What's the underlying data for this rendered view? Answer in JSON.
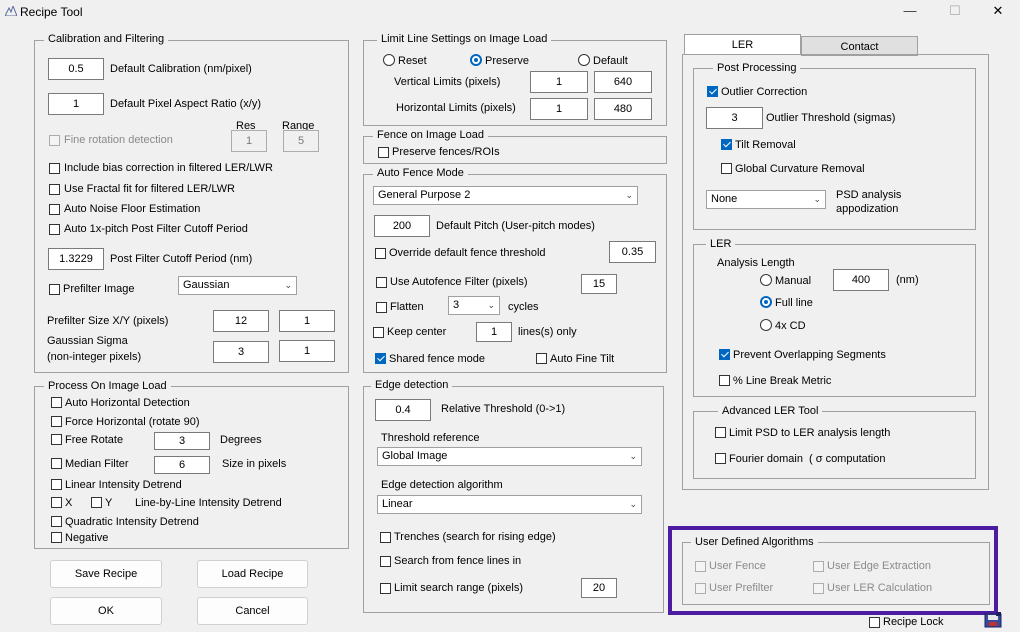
{
  "window": {
    "title": "Recipe Tool",
    "min": "—",
    "max": "☐",
    "close": "✕"
  },
  "calib": {
    "legend": "Calibration and Filtering",
    "cal_value": "0.5",
    "cal_label": "Default Calibration (nm/pixel)",
    "aspect_value": "1",
    "aspect_label": "Default Pixel Aspect Ratio (x/y)",
    "fine_rot_label": "Fine rotation detection",
    "res_label": "Res",
    "range_label": "Range",
    "res_value": "1",
    "range_value": "5",
    "bias_label": "Include bias correction in filtered LER/LWR",
    "fractal_label": "Use Fractal fit for filtered LER/LWR",
    "noise_label": "Auto Noise Floor Estimation",
    "pitch_label": "Auto 1x-pitch Post Filter Cutoff Period",
    "post_value": "1.3229",
    "post_label": "Post Filter Cutoff Period (nm)",
    "prefilter_label": "Prefilter Image",
    "prefilter_select": "Gaussian",
    "size_label": "Prefilter Size X/Y (pixels)",
    "size_x": "12",
    "size_y": "1",
    "sigma_label1": "Gaussian Sigma",
    "sigma_label2": "(non-integer pixels)",
    "sigma_x": "3",
    "sigma_y": "1"
  },
  "process": {
    "legend": "Process On Image Load",
    "auto_h": "Auto Horizontal Detection",
    "force_h": "Force Horizontal (rotate 90)",
    "free_rot": "Free Rotate",
    "free_rot_value": "3",
    "degrees": "Degrees",
    "median": "Median Filter",
    "median_value": "6",
    "size_px": "Size in pixels",
    "linear": "Linear Intensity Detrend",
    "x": "X",
    "y": "Y",
    "line_by_line": "Line-by-Line Intensity Detrend",
    "quadratic": "Quadratic Intensity Detrend",
    "negative": "Negative"
  },
  "buttons": {
    "save": "Save Recipe",
    "load": "Load Recipe",
    "ok": "OK",
    "cancel": "Cancel"
  },
  "limit": {
    "legend": "Limit Line Settings on Image Load",
    "reset": "Reset",
    "preserve": "Preserve",
    "default": "Default",
    "vert_label": "Vertical Limits (pixels)",
    "vert_a": "1",
    "vert_b": "640",
    "horiz_label": "Horizontal Limits (pixels)",
    "horiz_a": "1",
    "horiz_b": "480"
  },
  "fence": {
    "legend": "Fence on Image Load",
    "preserve": "Preserve fences/ROIs"
  },
  "autofence": {
    "legend": "Auto Fence Mode",
    "mode": "General Purpose 2",
    "pitch_value": "200",
    "pitch_label": "Default Pitch (User-pitch modes)",
    "override_label": "Override default fence threshold",
    "override_value": "0.35",
    "filter_label": "Use Autofence Filter (pixels)",
    "filter_value": "15",
    "flatten_label": "Flatten",
    "flatten_value": "3",
    "cycles": "cycles",
    "keep_label": "Keep center",
    "keep_value": "1",
    "lines_only": "lines(s) only",
    "shared_label": "Shared fence mode",
    "autotilt_label": "Auto Fine Tilt"
  },
  "edge": {
    "legend": "Edge detection",
    "rel_value": "0.4",
    "rel_label": "Relative Threshold (0->1)",
    "thr_ref_label": "Threshold reference",
    "thr_ref": "Global Image",
    "algo_label": "Edge detection algorithm",
    "algo": "Linear",
    "trenches": "Trenches (search for rising edge)",
    "search_fence": "Search from fence lines in",
    "limit_range": "Limit search range (pixels)",
    "limit_value": "20"
  },
  "tabs": {
    "ler": "LER",
    "contact": "Contact"
  },
  "post": {
    "legend": "Post Processing",
    "outlier": "Outlier Correction",
    "outlier_value": "3",
    "outlier_thr": "Outlier Threshold (sigmas)",
    "tilt": "Tilt Removal",
    "global": "Global Curvature Removal",
    "psd_select": "None",
    "psd_label1": "PSD analysis",
    "psd_label2": "appodization"
  },
  "ler": {
    "legend": "LER",
    "analysis": "Analysis Length",
    "manual": "Manual",
    "manual_value": "400",
    "nm": "(nm)",
    "full": "Full line",
    "cd": "4x CD",
    "prevent": "Prevent Overlapping Segments",
    "break": "% Line Break Metric"
  },
  "adv": {
    "legend": "Advanced LER Tool",
    "limit_psd": "Limit PSD to LER analysis length",
    "fourier": "Fourier domain",
    "sigma": "( σ computation"
  },
  "user": {
    "legend": "User Defined Algorithms",
    "fence": "User Fence",
    "edge": "User Edge Extraction",
    "prefilter": "User Prefilter",
    "ler": "User LER Calculation",
    "highlight": "#4b1ba0"
  },
  "footer": {
    "lock": "Recipe Lock"
  }
}
